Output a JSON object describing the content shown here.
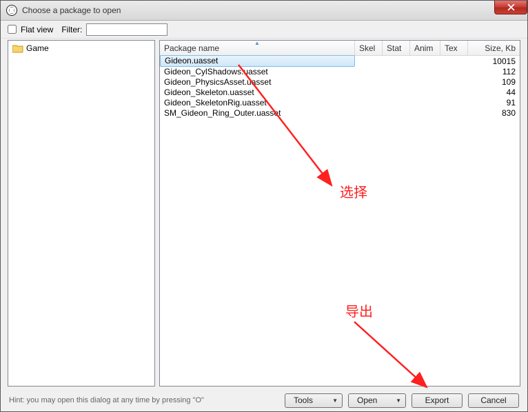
{
  "window": {
    "title": "Choose a package to open"
  },
  "filterbar": {
    "flat_view_label": "Flat view",
    "filter_label": "Filter:",
    "filter_value": ""
  },
  "tree": {
    "items": [
      {
        "label": "Game"
      }
    ]
  },
  "columns": {
    "package": "Package name",
    "skel": "Skel",
    "stat": "Stat",
    "anim": "Anim",
    "tex": "Tex",
    "size": "Size, Kb"
  },
  "rows": [
    {
      "name": "Gideon.uasset",
      "skel": "",
      "stat": "",
      "anim": "",
      "tex": "",
      "size": "10015",
      "selected": true
    },
    {
      "name": "Gideon_CylShadows.uasset",
      "skel": "",
      "stat": "",
      "anim": "",
      "tex": "",
      "size": "112",
      "selected": false
    },
    {
      "name": "Gideon_PhysicsAsset.uasset",
      "skel": "",
      "stat": "",
      "anim": "",
      "tex": "",
      "size": "109",
      "selected": false
    },
    {
      "name": "Gideon_Skeleton.uasset",
      "skel": "",
      "stat": "",
      "anim": "",
      "tex": "",
      "size": "44",
      "selected": false
    },
    {
      "name": "Gideon_SkeletonRig.uasset",
      "skel": "",
      "stat": "",
      "anim": "",
      "tex": "",
      "size": "91",
      "selected": false
    },
    {
      "name": "SM_Gideon_Ring_Outer.uasset",
      "skel": "",
      "stat": "",
      "anim": "",
      "tex": "",
      "size": "830",
      "selected": false
    }
  ],
  "footer": {
    "hint": "Hint: you may open this dialog at any time by pressing \"O\"",
    "tools_label": "Tools",
    "open_label": "Open",
    "export_label": "Export",
    "cancel_label": "Cancel"
  },
  "annotations": {
    "select_label": "选择",
    "export_label": "导出"
  }
}
